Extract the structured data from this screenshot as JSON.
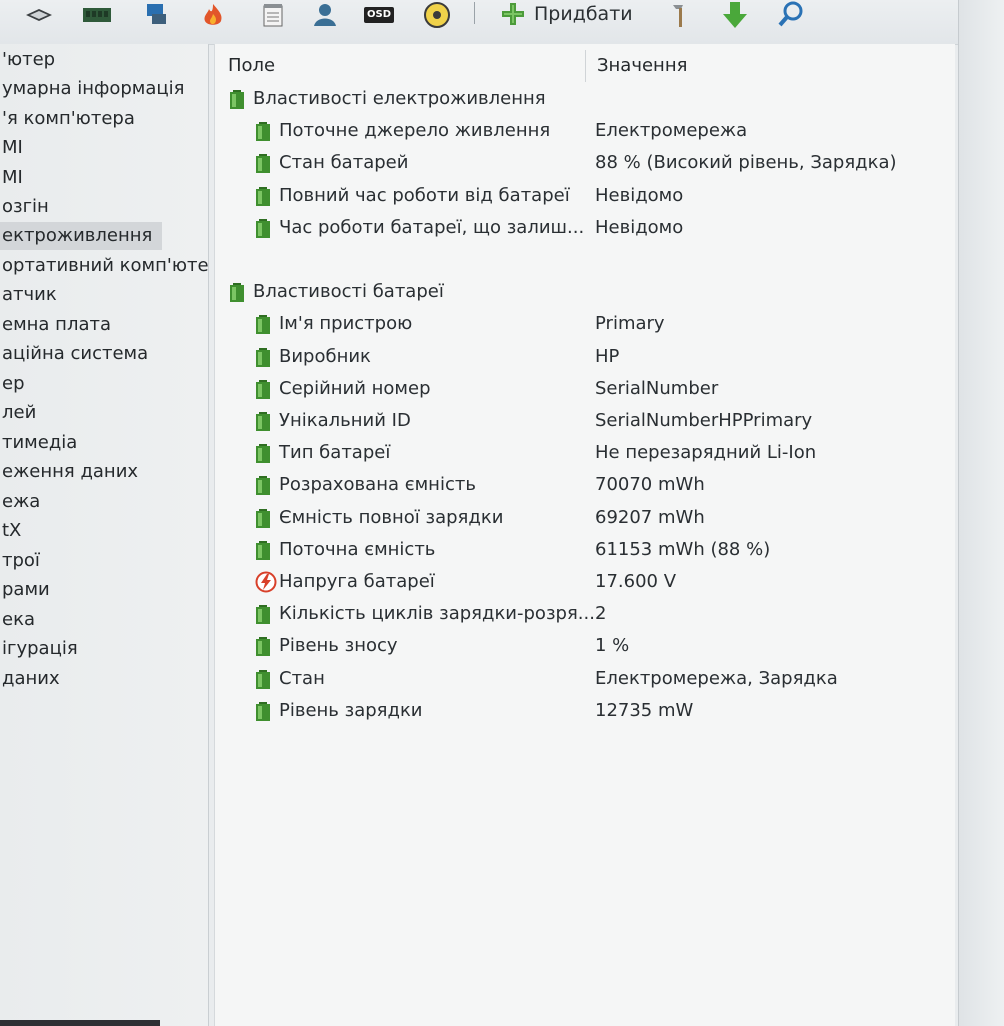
{
  "toolbar": {
    "add_label": "Придбати",
    "osd_label": "OSD",
    "icons": [
      "display-icon",
      "memory-icon",
      "network-icon",
      "fire-icon",
      "report-icon",
      "user-icon",
      "osd-icon",
      "disc-icon",
      "add-icon",
      "tools-icon",
      "download-icon",
      "search-icon"
    ]
  },
  "sidebar": {
    "items": [
      {
        "label": "'ютер"
      },
      {
        "label": "умарна інформація"
      },
      {
        "label": "'я комп'ютера"
      },
      {
        "label": "MI"
      },
      {
        "label": "MI"
      },
      {
        "label": "озгін"
      },
      {
        "label": "ектроживлення"
      },
      {
        "label": "ортативний комп'юте"
      },
      {
        "label": "атчик"
      },
      {
        "label": "емна плата"
      },
      {
        "label": "аційна система"
      },
      {
        "label": "ер"
      },
      {
        "label": "лей"
      },
      {
        "label": "тимедіа"
      },
      {
        "label": "еження даних"
      },
      {
        "label": "ежа"
      },
      {
        "label": "tX"
      },
      {
        "label": "трої"
      },
      {
        "label": "рами"
      },
      {
        "label": "ека"
      },
      {
        "label": "ігурація"
      },
      {
        "label": "даних"
      }
    ]
  },
  "table": {
    "col_field": "Поле",
    "col_value": "Значення",
    "groups": [
      {
        "title": "Властивості електроживлення",
        "rows": [
          {
            "field": "Поточне джерело живлення",
            "value": "Електромережа"
          },
          {
            "field": "Стан батарей",
            "value": "88 % (Високий рівень, Зарядка)"
          },
          {
            "field": "Повний час роботи від батареї",
            "value": "Невідомо"
          },
          {
            "field": "Час роботи батареї, що залиш...",
            "value": "Невідомо"
          }
        ]
      },
      {
        "title": "Властивості батареї",
        "rows": [
          {
            "field": "Ім'я пристрою",
            "value": "Primary"
          },
          {
            "field": "Виробник",
            "value": "HP"
          },
          {
            "field": "Серійний номер",
            "value": "SerialNumber"
          },
          {
            "field": "Унікальний ID",
            "value": "SerialNumberHPPrimary"
          },
          {
            "field": "Тип батареї",
            "value": "Не перезарядний Li-Ion"
          },
          {
            "field": "Розрахована ємність",
            "value": "70070 mWh"
          },
          {
            "field": "Ємність повної зарядки",
            "value": "69207 mWh"
          },
          {
            "field": "Поточна ємність",
            "value": "61153 mWh  (88 %)"
          },
          {
            "field": "Напруга батареї",
            "value": "17.600 V"
          },
          {
            "field": "Кількість циклів зарядки-розря...",
            "value": "2"
          },
          {
            "field": "Рівень зносу",
            "value": "1 %"
          },
          {
            "field": "Стан",
            "value": "Електромережа, Зарядка"
          },
          {
            "field": "Рівень зарядки",
            "value": "12735 mW"
          }
        ]
      }
    ]
  },
  "colors": {
    "battery_green": "#3f8f2f",
    "voltage_red": "#d8402a",
    "selection": "#d3d6d9"
  }
}
